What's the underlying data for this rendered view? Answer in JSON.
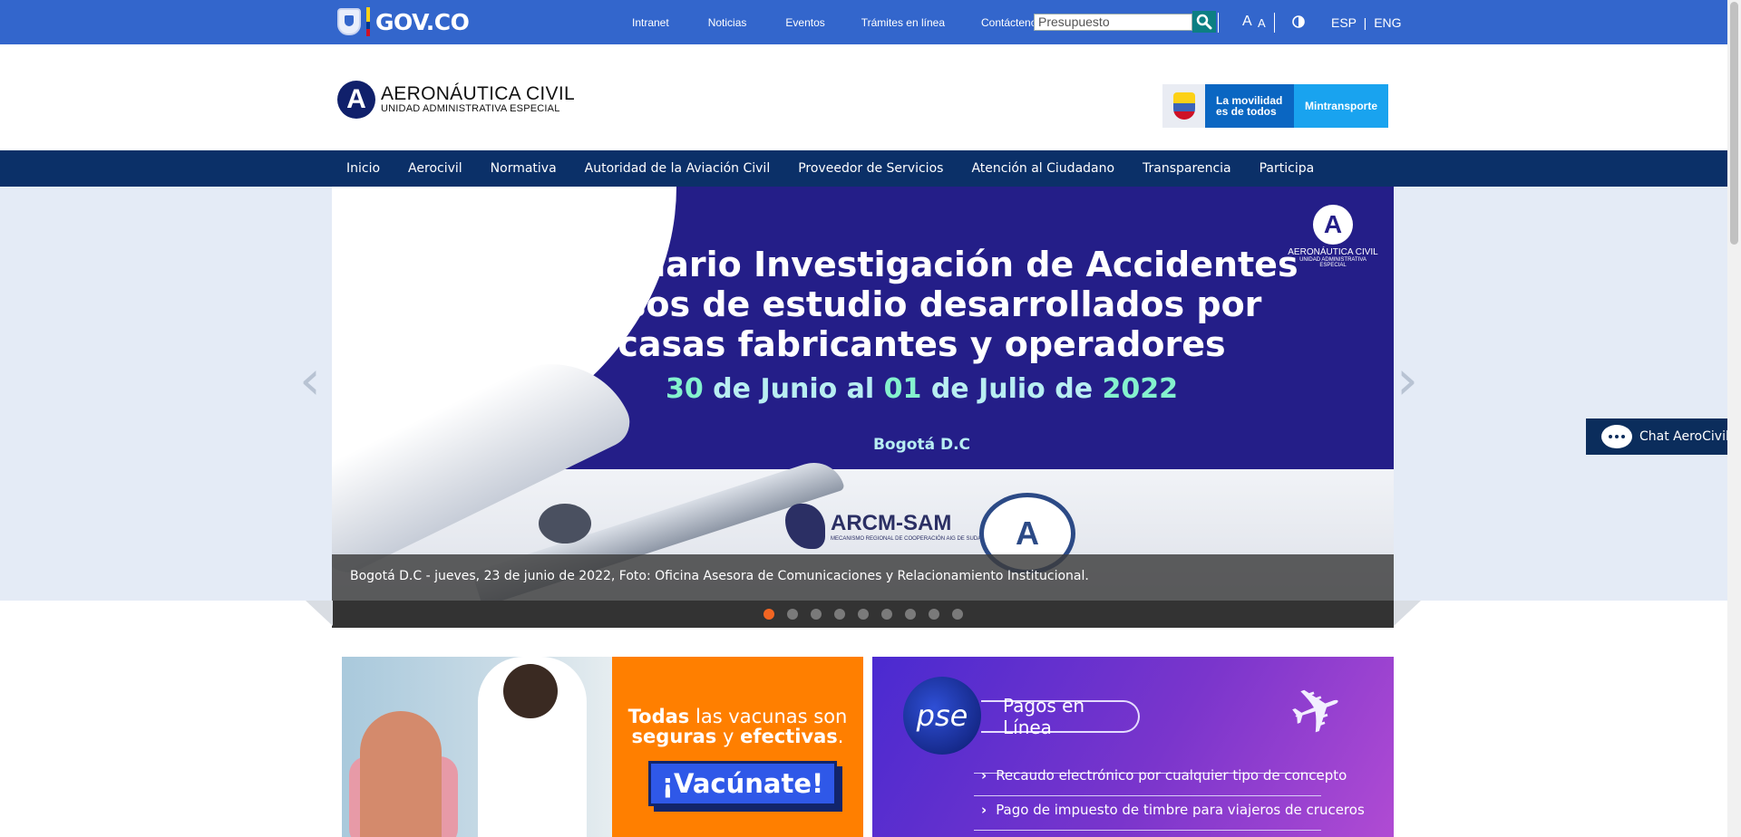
{
  "govbar": {
    "logo_text": "GOV.CO",
    "links": [
      "Intranet",
      "Noticias",
      "Eventos",
      "Trámites en línea",
      "Contáctenos"
    ],
    "search_value": "Presupuesto",
    "font_large": "A",
    "font_small": "A",
    "lang_es": "ESP",
    "lang_sep": "|",
    "lang_en": "ENG"
  },
  "header": {
    "logo_mark": "A",
    "brand_name": "AERONÁUTICA CIVIL",
    "brand_sub": "UNIDAD ADMINISTRATIVA ESPECIAL",
    "mintra_tagline_1": "La movilidad",
    "mintra_tagline_2": "es de todos",
    "mintra_label": "Mintransporte"
  },
  "nav": {
    "items": [
      "Inicio",
      "Aerocivil",
      "Normativa",
      "Autoridad de la Aviación Civil",
      "Proveedor de Servicios",
      "Atención al Ciudadano",
      "Transparencia",
      "Participa"
    ]
  },
  "slider": {
    "title_lines": [
      "Seminario Investigación de Accidentes",
      "casos de estudio desarrollados por",
      "casas fabricantes y operadores"
    ],
    "date_parts": [
      "30",
      " de Junio al ",
      "01",
      " de Julio de ",
      "2022"
    ],
    "city": "Bogotá D.C",
    "badge_mark": "A",
    "badge_line_1": "AERONÁUTICA CIVIL",
    "badge_line_2": "UNIDAD ADMINISTRATIVA ESPECIAL",
    "arcm_title": "ARCM-SAM",
    "arcm_sub": "MECANISMO REGIONAL DE COOPERACIÓN AIG DE SUDAMÉRICA",
    "ditc_mark": "A",
    "caption": "Bogotá D.C - jueves, 23 de junio de 2022, Foto: Oficina Asesora de Comunicaciones y Relacionamiento Institucional.",
    "dot_count": 9,
    "active_dot": 0,
    "prev_arrow": "‹",
    "next_arrow": "›"
  },
  "chat": {
    "label": "Chat AeroCivil"
  },
  "cards": {
    "vacuna_bold_1": "Todas",
    "vacuna_text_1": " las vacunas son",
    "vacuna_bold_2": "seguras",
    "vacuna_text_2": " y ",
    "vacuna_bold_3": "efectivas",
    "vacuna_text_3": ".",
    "vacuna_button": "¡Vacúnate!",
    "pse_logo": "pse",
    "pse_title": "Pagos en Línea",
    "pse_items": [
      "Recaudo electrónico por cualquier tipo de concepto",
      "Pago de impuesto de timbre para viajeros de cruceros"
    ]
  },
  "colors": {
    "govbar": "#3366cc",
    "nav": "#0b3068",
    "banner": "#241e88",
    "active_dot": "#f26522",
    "vacuna_orange": "#ff7f00"
  }
}
